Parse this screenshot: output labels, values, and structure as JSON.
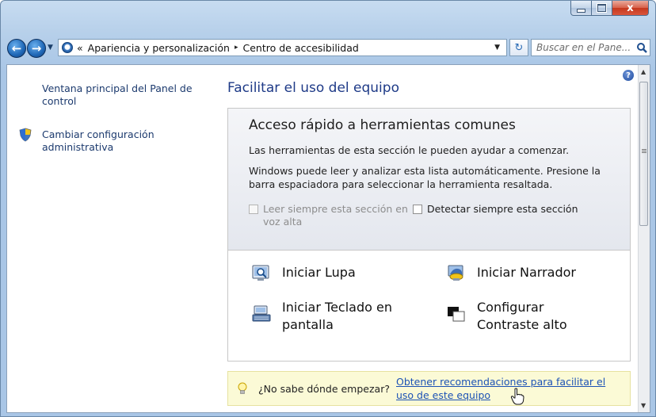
{
  "window": {
    "caption_buttons": {
      "minimize": "minimize",
      "maximize": "maximize",
      "close_label": "x"
    }
  },
  "nav": {
    "breadcrumb_prefix": "«",
    "breadcrumbs": [
      "Apariencia y personalización",
      "Centro de accesibilidad"
    ],
    "breadcrumb_separator": "▸",
    "search_placeholder": "Buscar en el Pane..."
  },
  "sidebar": {
    "items": [
      {
        "label": "Ventana principal del Panel de control"
      },
      {
        "label": "Cambiar configuración administrativa",
        "icon": "shield-icon"
      }
    ]
  },
  "main": {
    "title": "Facilitar el uso del equipo",
    "quick_access": {
      "heading": "Acceso rápido a herramientas comunes",
      "line1": "Las herramientas de esta sección le pueden ayudar a comenzar.",
      "line2": "Windows puede leer y analizar esta lista automáticamente. Presione la barra espaciadora para seleccionar la herramienta resaltada.",
      "checkbox_read": {
        "label": "Leer siempre esta sección en voz alta",
        "checked": false,
        "enabled": false
      },
      "checkbox_scan": {
        "label": "Detectar siempre esta sección",
        "checked": false,
        "enabled": true
      },
      "tools": [
        {
          "label": "Iniciar Lupa",
          "icon": "magnifier-icon"
        },
        {
          "label": "Iniciar Narrador",
          "icon": "narrator-icon"
        },
        {
          "label": "Iniciar Teclado en pantalla",
          "icon": "keyboard-icon"
        },
        {
          "label": "Configurar Contraste alto",
          "icon": "contrast-icon"
        }
      ]
    },
    "tip": {
      "question": "¿No sabe dónde empezar?",
      "link": "Obtener recomendaciones para facilitar el uso de este equipo"
    }
  },
  "colors": {
    "link": "#1c52b5",
    "title_blue": "#1e3a87",
    "tip_background": "#fbfad6",
    "frame": "#b7d0ea"
  }
}
